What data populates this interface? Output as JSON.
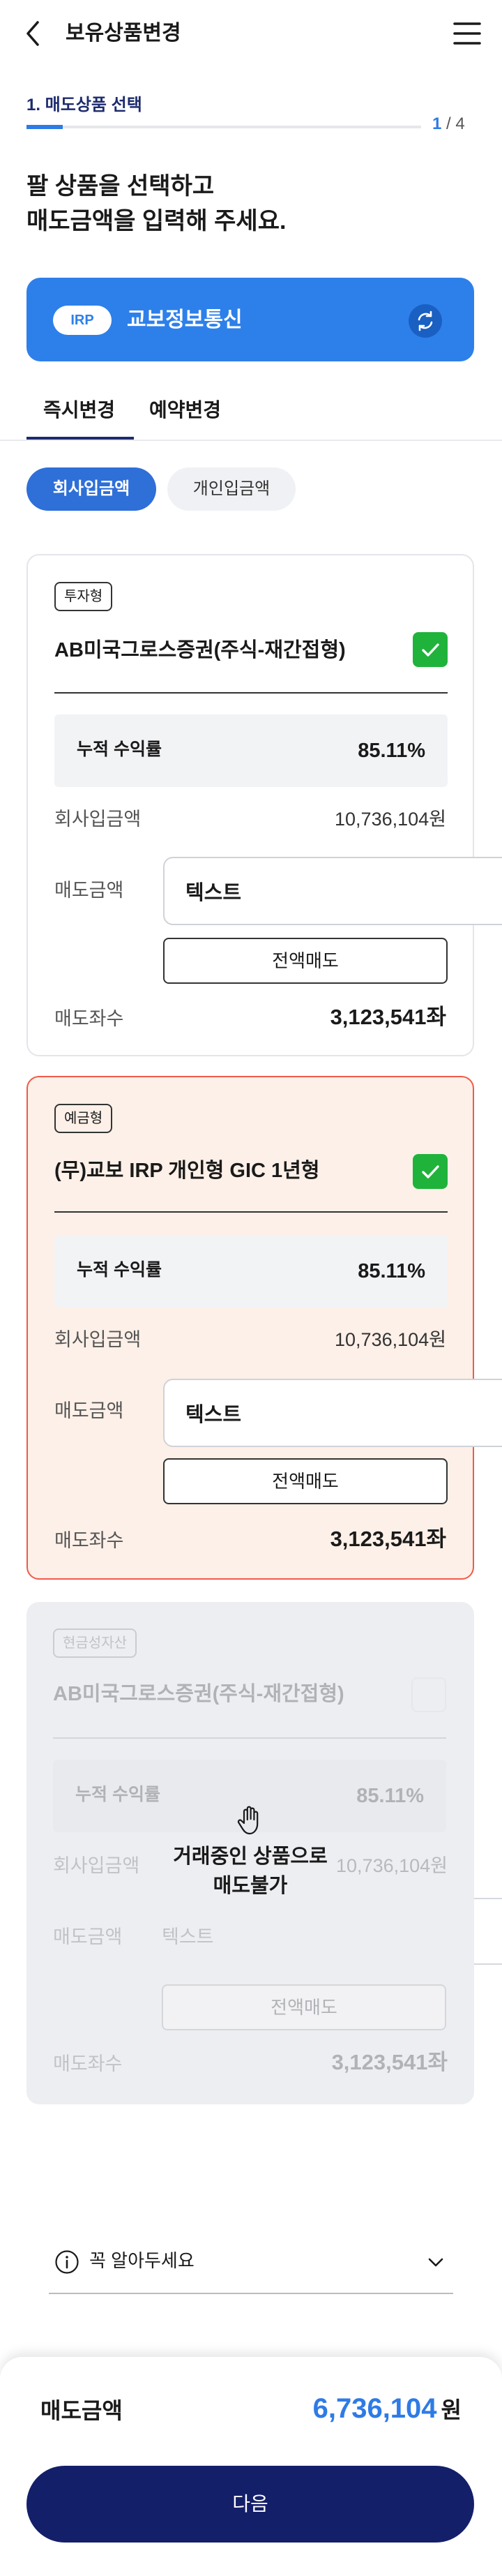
{
  "header": {
    "title": "보유상품변경",
    "back_icon": "chevron-left-icon",
    "menu_icon": "hamburger-menu-icon"
  },
  "step": {
    "label": "1. 매도상품 선택",
    "current": "1",
    "total": " / 4",
    "progress": 0.25
  },
  "headline": {
    "line1": "팔 상품을 선택하고",
    "line2": "매도금액을 입력해 주세요."
  },
  "account": {
    "badge": "IRP",
    "name": "교보정보통신",
    "refresh_icon": "refresh-icon",
    "color": "#2d80ea"
  },
  "tabs": [
    {
      "label": "즉시변경",
      "active": true
    },
    {
      "label": "예약변경",
      "active": false
    }
  ],
  "chips": [
    {
      "label": "회사입금액",
      "active": true
    },
    {
      "label": "개인입금액",
      "active": false
    }
  ],
  "labels": {
    "return": "누적 수익률",
    "company_deposit": "회사입금액",
    "sell_amount": "매도금액",
    "sell_all": "전액매도",
    "sell_units": "매도좌수"
  },
  "products": [
    {
      "tag": "투자형",
      "name": "AB미국그로스증권(주식-재간접형)",
      "checked": true,
      "return": "85.11%",
      "deposit": "10,736,104원",
      "input_value": "텍스트",
      "units": "3,123,541좌"
    },
    {
      "tag": "예금형",
      "name": "(무)교보 IRP 개인형 GIC 1년형",
      "checked": true,
      "return": "85.11%",
      "deposit": "10,736,104원",
      "input_value": "텍스트",
      "units": "3,123,541좌"
    },
    {
      "tag": "현금성자산",
      "name": "AB미국그로스증권(주식-재간접형)",
      "checked": false,
      "return": "85.11%",
      "deposit": "10,736,104원",
      "input_value": "텍스트",
      "units": "3,123,541좌",
      "overlay_line1": "거래중인 상품으로",
      "overlay_line2": "매도불가"
    }
  ],
  "notice": {
    "text": "꼭 알아두세요"
  },
  "summary": {
    "label": "매도금액",
    "value": "6,736,104",
    "unit": "원"
  },
  "next_button": "다음",
  "colors": {
    "primary": "#2e7be6",
    "navy": "#141f6a",
    "check": "#1fb33b",
    "selected_border": "#f05a4a",
    "selected_bg": "#fdf0e8"
  }
}
